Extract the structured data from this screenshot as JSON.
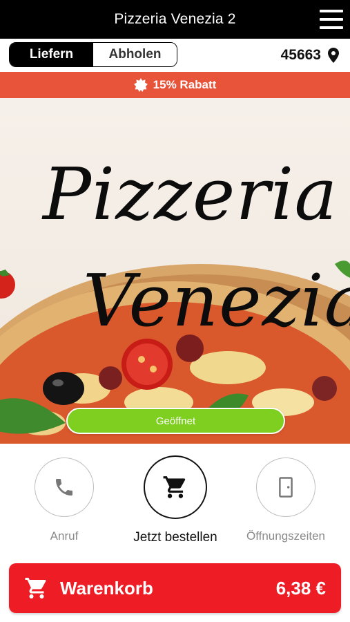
{
  "header": {
    "title": "Pizzeria Venezia 2",
    "menu_icon": "hamburger-menu-icon"
  },
  "order_mode": {
    "options": [
      {
        "label": "Liefern",
        "selected": true
      },
      {
        "label": "Abholen",
        "selected": false
      }
    ],
    "postcode": "45663",
    "postcode_icon": "location-pin-icon"
  },
  "promo": {
    "icon": "badge-icon",
    "text": "15% Rabatt",
    "color": "#e8543a"
  },
  "hero": {
    "logo_line1": "Pizzeria",
    "logo_line2": "Venezia",
    "status": "Geöffnet",
    "status_color": "#7ecf1f"
  },
  "actions": [
    {
      "label": "Anruf",
      "icon": "phone-icon"
    },
    {
      "label": "Jetzt bestellen",
      "icon": "shopping-cart-icon"
    },
    {
      "label": "Öffnungszeiten",
      "icon": "door-icon"
    }
  ],
  "cart": {
    "label": "Warenkorb",
    "total": "6,38 €",
    "icon": "shopping-cart-icon",
    "color": "#ee1c25"
  }
}
